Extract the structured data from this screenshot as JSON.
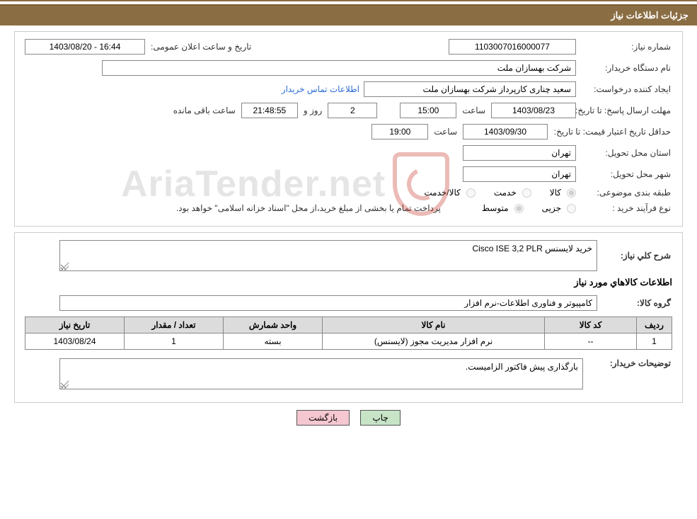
{
  "header": {
    "title": "جزئیات اطلاعات نیاز"
  },
  "row1": {
    "need_no_label": "شماره نیاز:",
    "need_no": "1103007016000077",
    "announce_label": "تاریخ و ساعت اعلان عمومی:",
    "announce": "1403/08/20 - 16:44"
  },
  "row2": {
    "buyer_org_label": "نام دستگاه خریدار:",
    "buyer_org": "شرکت بهسازان ملت"
  },
  "row3": {
    "requester_label": "ایجاد کننده درخواست:",
    "requester": "سعید چناری کارپرداز شرکت بهسازان ملت",
    "contact_link": "اطلاعات تماس خریدار"
  },
  "row4": {
    "deadline_label": "مهلت ارسال پاسخ:  تا تاریخ:",
    "deadline_date": "1403/08/23",
    "time_label": "ساعت",
    "deadline_time": "15:00",
    "days": "2",
    "days_and": "روز و",
    "countdown": "21:48:55",
    "remaining": "ساعت باقی مانده"
  },
  "row5": {
    "min_valid_label": "حداقل تاریخ اعتبار قیمت: تا تاریخ:",
    "min_valid_date": "1403/09/30",
    "time_label": "ساعت",
    "min_valid_time": "19:00"
  },
  "row6": {
    "province_label": "استان محل تحویل:",
    "province": "تهران"
  },
  "row7": {
    "city_label": "شهر محل تحویل:",
    "city": "تهران"
  },
  "row8": {
    "category_label": "طبقه بندی موضوعی:",
    "opt_goods": "کالا",
    "opt_service": "خدمت",
    "opt_both": "کالا/خدمت"
  },
  "row9": {
    "process_label": "نوع فرآیند خرید :",
    "opt_minor": "جزیی",
    "opt_medium": "متوسط",
    "note": "پرداخت تمام یا بخشی از مبلغ خرید،از محل \"اسناد خزانه اسلامی\" خواهد بود."
  },
  "sec2": {
    "desc_label": "شرح کلي نياز:",
    "desc": "خرید لایسنس Cisco ISE 3,2 PLR",
    "goods_hdr": "اطلاعات كالاهاي مورد نياز",
    "group_label": "گروه کالا:",
    "group": "کامپیوتر و فناوری اطلاعات-نرم افزار",
    "table": {
      "headers": [
        "رديف",
        "کد کالا",
        "نام کالا",
        "واحد شمارش",
        "تعداد / مقدار",
        "تاريخ نياز"
      ],
      "rows": [
        [
          "1",
          "--",
          "نرم افزار مدیریت مجوز (لایسنس)",
          "بسته",
          "1",
          "1403/08/24"
        ]
      ]
    },
    "buyer_notes_label": "توضيحات خريدار:",
    "buyer_notes": "بارگذاری پیش فاکتور الزامیست."
  },
  "buttons": {
    "print": "چاپ",
    "back": "بازگشت"
  },
  "watermark": "AriaTender.net"
}
